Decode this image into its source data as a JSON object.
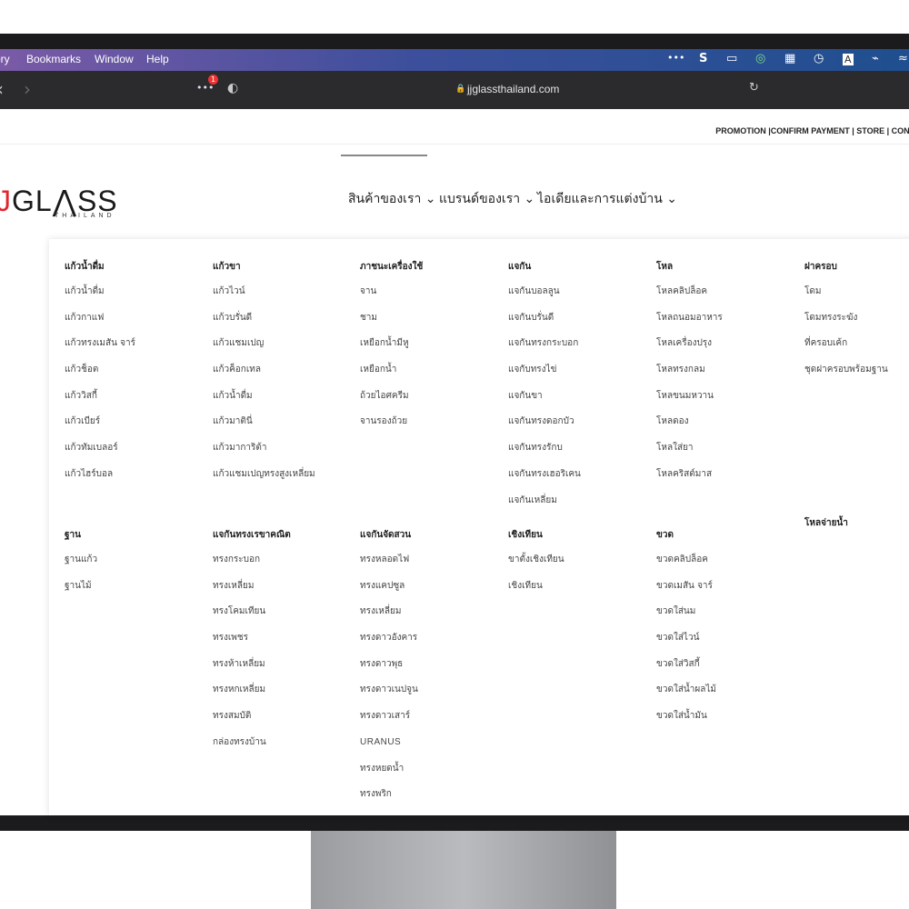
{
  "menubar": {
    "items": [
      "ory",
      "Bookmarks",
      "Window",
      "Help"
    ],
    "tray_icons": [
      "more-icon",
      "s-app-icon",
      "cast-icon",
      "chat-icon",
      "layout-icon",
      "history-icon",
      "text-icon",
      "wifi-off-icon",
      "flag-icon"
    ],
    "tray_glyphs": [
      "•••",
      "S",
      "▭",
      "◎",
      "▦",
      "◷",
      "A",
      "⌁",
      "≈"
    ]
  },
  "toolbar": {
    "back": "‹",
    "forward": "›",
    "extensions": "•••",
    "extensions_badge": "1",
    "shield": "◐",
    "url": "jjglassthailand.com",
    "lock": "🔒",
    "reload": "↻"
  },
  "header": {
    "top_links": "PROMOTION |CONFIRM PAYMENT | STORE | CONTA",
    "logo_j": "J",
    "logo_text": "GL⋀SS",
    "logo_sub": "THAILAND",
    "nav": [
      {
        "label": "สินค้าของเรา ⌄"
      },
      {
        "label": "แบรนด์ของเรา ⌄"
      },
      {
        "label": "ไอเดียและการแต่งบ้าน ⌄"
      }
    ]
  },
  "menu": {
    "row1": [
      {
        "head": "แก้วน้ำดื่ม",
        "items": [
          "แก้วน้ำดื่ม",
          "แก้วกาแฟ",
          "แก้วทรงเมสัน จาร์",
          "แก้วช็อต",
          "แก้ววิสกี้",
          "แก้วเบียร์",
          "แก้วทัมเบลอร์",
          "แก้วไฮร์บอล"
        ]
      },
      {
        "head": "แก้วขา",
        "items": [
          "แก้วไวน์",
          "แก้วบรั่นดี",
          "แก้วแชมเปญ",
          "แก้วค็อกเทล",
          "แก้วน้ำดื่ม",
          "แก้วมาตินี่",
          "แก้วมาการิต้า",
          "แก้วแชมเปญทรงสูงเหลี่ยม"
        ]
      },
      {
        "head": "ภาชนะเครื่องใช้",
        "items": [
          "จาน",
          "ชาม",
          "เหยือกน้ำมีหู",
          "เหยือกน้ำ",
          "ถ้วยไอศครีม",
          "จานรองถ้วย"
        ]
      },
      {
        "head": "แจกัน",
        "items": [
          "แจกันบอลลูน",
          "แจกันบรั่นดี",
          "แจกันทรงกระบอก",
          "แจกับทรงไข่",
          "แจกันขา",
          "แจกันทรงดอกบัว",
          "แจกันทรงรักบ",
          "แจกันทรงเฮอริเคน",
          "แจกันเหลี่ยม"
        ]
      },
      {
        "head": "โหล",
        "items": [
          "โหลคลิปล็อค",
          "โหลถนอมอาหาร",
          "โหลเครื่องปรุง",
          "โหลทรงกลม",
          "โหลขนมหวาน",
          "โหลดอง",
          "โหลใส่ยา",
          "โหลคริสต์มาส"
        ]
      },
      {
        "head": "ฝาครอบ",
        "items": [
          "โดม",
          "โดมทรงระฆัง",
          "ที่ครอบเค้ก",
          "ชุดฝาครอบพร้อมฐาน"
        ]
      }
    ],
    "row2": [
      {
        "head": "ฐาน",
        "items": [
          "ฐานแก้ว",
          "ฐานไม้"
        ]
      },
      {
        "head": "แจกันทรงเรขาคณิต",
        "items": [
          "ทรงกระบอก",
          "ทรงเหลี่ยม",
          "ทรงโคมเทียน",
          "ทรงเพชร",
          "ทรงห้าเหลี่ยม",
          "ทรงหกเหลี่ยม",
          "ทรงสมบัติ",
          "กล่องทรงบ้าน"
        ]
      },
      {
        "head": "แจกันจัดสวน",
        "items": [
          "ทรงหลอดไฟ",
          "ทรงแคปซูล",
          "ทรงเหลี่ยม",
          "ทรงดาวอังคาร",
          "ทรงดาวพุธ",
          "ทรงดาวเนปจูน",
          "ทรงดาวเสาร์",
          "URANUS",
          "ทรงหยดน้ำ",
          "ทรงพริก"
        ]
      },
      {
        "head": "เชิงเทียน",
        "items": [
          "ขาตั้งเชิงเทียน",
          "เชิงเทียน"
        ]
      },
      {
        "head": "ขวด",
        "items": [
          "ขวดคลิปล็อค",
          "ขวดเมสัน จาร์",
          "ขวดใส่นม",
          "ขวดใส่ไวน์",
          "ขวดใส่วิสกี้",
          "ขวดใส่น้ำผลไม้",
          "ขวดใส่น้ำมัน"
        ]
      },
      {
        "head": "โหลจ่ายน้ำ",
        "items": []
      }
    ]
  }
}
